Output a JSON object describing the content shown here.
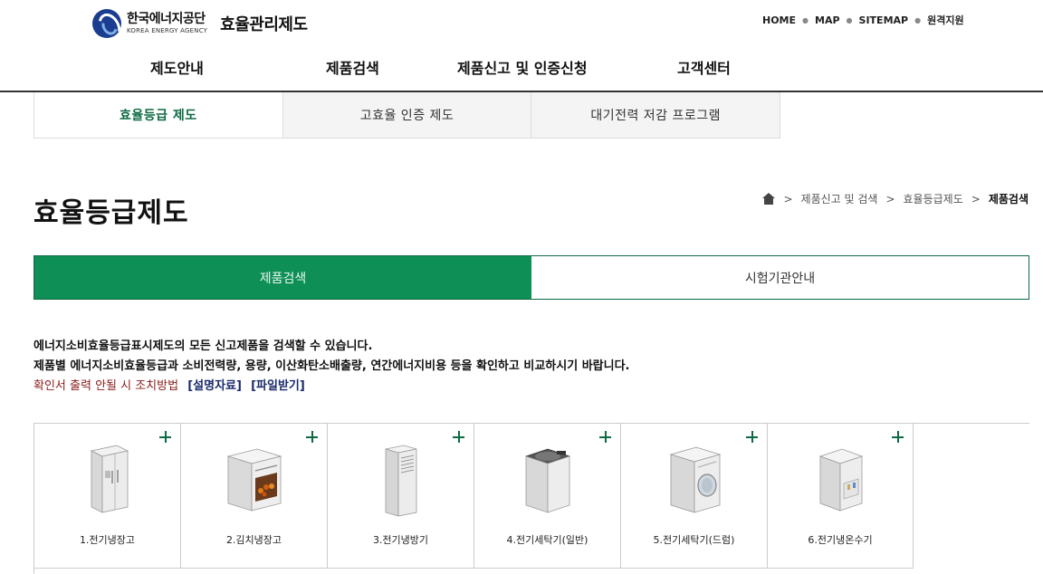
{
  "header": {
    "logo_kr": "한국에너지공단",
    "logo_en": "KOREA ENERGY AGENCY",
    "site_title": "효율관리제도",
    "util": [
      "HOME",
      "MAP",
      "SITEMAP",
      "원격지원"
    ],
    "gnb": [
      "제도안내",
      "제품검색",
      "제품신고 및 인증신청",
      "고객센터"
    ]
  },
  "subtabs": [
    "효율등급 제도",
    "고효율 인증 제도",
    "대기전력 저감 프로그램"
  ],
  "page_title": "효율등급제도",
  "breadcrumb": [
    "제품신고 및 검색",
    "효율등급제도",
    "제품검색"
  ],
  "maintabs": [
    "제품검색",
    "시험기관안내"
  ],
  "desc": {
    "line1": "에너지소비효율등급표시제도의 모든 신고제품을 검색할 수 있습니다.",
    "line2": "제품별 에너지소비효율등급과 소비전력량, 용량, 이산화탄소배출량, 연간에너지비용 등을 확인하고 비교하시기 바랍니다.",
    "warn": "확인서 출력 안될 시 조치방법",
    "link1": "[설명자료]",
    "link2": "[파일받기]"
  },
  "products": [
    {
      "label": "1.전기냉장고",
      "icon": "refrigerator-icon"
    },
    {
      "label": "2.김치냉장고",
      "icon": "kimchi-refrigerator-icon"
    },
    {
      "label": "3.전기냉방기",
      "icon": "air-conditioner-icon"
    },
    {
      "label": "4.전기세탁기(일반)",
      "icon": "top-load-washer-icon"
    },
    {
      "label": "5.전기세탁기(드럼)",
      "icon": "drum-washer-icon"
    },
    {
      "label": "6.전기냉온수기",
      "icon": "water-dispenser-icon"
    }
  ],
  "colors": {
    "accent_green": "#0d8f55",
    "dark_green": "#0d6b43",
    "warn_red": "#8b1a1a",
    "link_navy": "#1a2a6b"
  }
}
